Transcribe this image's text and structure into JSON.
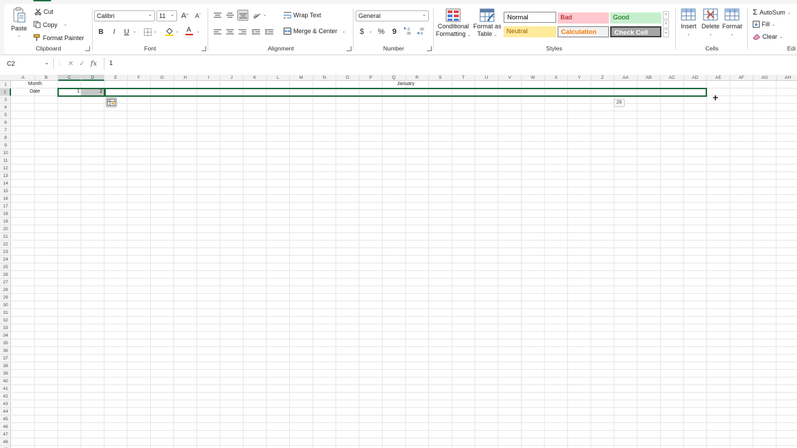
{
  "ribbon": {
    "clipboard": {
      "paste": "Paste",
      "cut": "Cut",
      "copy": "Copy",
      "format_painter": "Format Painter",
      "label": "Clipboard"
    },
    "font": {
      "name": "Calibri",
      "size": "11",
      "label": "Font",
      "bold": "B",
      "italic": "I",
      "underline": "U",
      "grow": "A",
      "shrink": "A",
      "font_color_letter": "A"
    },
    "alignment": {
      "wrap_text": "Wrap Text",
      "merge_center": "Merge & Center",
      "label": "Alignment"
    },
    "number": {
      "format": "General",
      "currency": "$",
      "percent": "%",
      "comma": "9",
      "label": "Number"
    },
    "styles": {
      "conditional_line1": "Conditional",
      "conditional_line2": "Formatting",
      "format_table_line1": "Format as",
      "format_table_line2": "Table",
      "normal": "Normal",
      "bad": "Bad",
      "good": "Good",
      "neutral": "Neutral",
      "calculation": "Calculation",
      "check_cell": "Check Cell",
      "label": "Styles"
    },
    "cells": {
      "insert": "Insert",
      "delete": "Delete",
      "format": "Format",
      "label": "Cells"
    },
    "editing": {
      "autosum": "AutoSum",
      "fill": "Fill",
      "clear": "Clear",
      "label": "Edi"
    },
    "colors": {
      "accent": "#1e7145",
      "bad_bg": "#ffc7ce",
      "bad_fg": "#9c0006",
      "good_bg": "#c6efce",
      "good_fg": "#006100",
      "neutral_bg": "#ffeb9c",
      "neutral_fg": "#9c5700",
      "calc_fg": "#fa7d00",
      "check_bg": "#a5a5a5"
    }
  },
  "formula_bar": {
    "name_box": "C2",
    "fx": "fx",
    "value": "1"
  },
  "sheet": {
    "columns": [
      "A",
      "B",
      "C",
      "D",
      "E",
      "F",
      "G",
      "H",
      "I",
      "J",
      "K",
      "L",
      "M",
      "N",
      "O",
      "P",
      "Q",
      "R",
      "S",
      "T",
      "U",
      "V",
      "W",
      "X",
      "Y",
      "Z",
      "AA",
      "AB",
      "AC",
      "AD",
      "AE",
      "AF",
      "AG",
      "AH"
    ],
    "rows": [
      "1",
      "2",
      "3",
      "4",
      "5",
      "6",
      "7",
      "8",
      "9",
      "10",
      "11",
      "12",
      "13",
      "14",
      "15",
      "16",
      "17",
      "18",
      "19",
      "20",
      "21",
      "22",
      "23",
      "24",
      "25",
      "26",
      "27",
      "28",
      "29",
      "30",
      "31",
      "32",
      "33",
      "34",
      "35",
      "36",
      "37",
      "38",
      "39",
      "40",
      "41",
      "42",
      "43",
      "44",
      "45",
      "46",
      "47",
      "48",
      "49",
      "50"
    ],
    "selected_columns": [
      "C",
      "D"
    ],
    "selected_row": "2",
    "cells": {
      "A1": "Month",
      "A2": "Date",
      "month_value": "January",
      "C2": "1",
      "D2": "2"
    },
    "fill_tooltip": "28"
  }
}
